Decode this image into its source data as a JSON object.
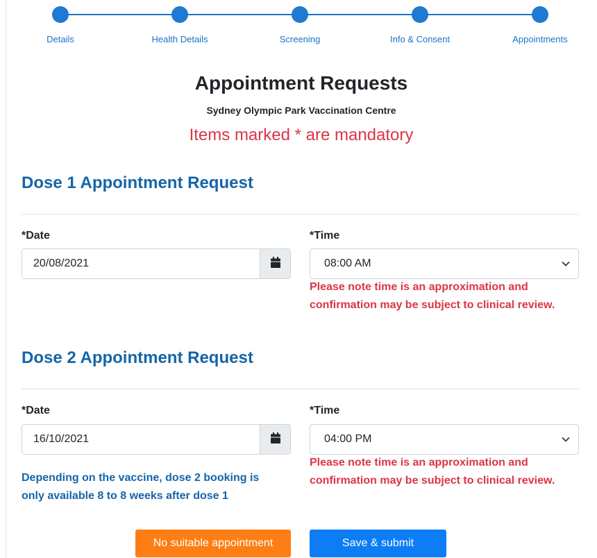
{
  "steps": [
    "Details",
    "Health Details",
    "Screening",
    "Info & Consent",
    "Appointments"
  ],
  "header": {
    "title": "Appointment Requests",
    "subtitle": "Sydney Olympic Park Vaccination Centre",
    "mandatory_note": "Items marked * are mandatory"
  },
  "dose1": {
    "title": "Dose 1 Appointment Request",
    "date_label": "*Date",
    "date_value": "20/08/2021",
    "time_label": "*Time",
    "time_value": "08:00 AM",
    "warning_line1": "Please note time is an approximation and",
    "warning_line2": "confirmation may be subject to clinical review."
  },
  "dose2": {
    "title": "Dose 2 Appointment Request",
    "date_label": "*Date",
    "date_value": "16/10/2021",
    "time_label": "*Time",
    "time_value": "04:00 PM",
    "warning_line1": "Please note time is an approximation and",
    "warning_line2": "confirmation may be subject to clinical review.",
    "info_line1": "Depending on the vaccine, dose 2 booking is",
    "info_line2": "only available 8 to 8 weeks after dose 1"
  },
  "buttons": {
    "no_suitable": "No suitable appointment",
    "save_submit": "Save & submit"
  },
  "colors": {
    "accent": "#1e7ad3",
    "heading_blue": "#1565a9",
    "error_red": "#dc3545",
    "orange": "#fd7e14",
    "primary_button": "#0d7df5"
  },
  "icons": {
    "calendar": "calendar-icon",
    "chevron": "chevron-down-icon"
  }
}
